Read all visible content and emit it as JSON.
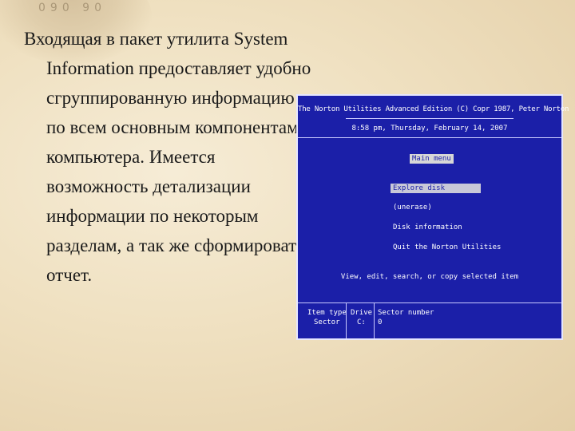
{
  "background": {
    "compass_marks": "090  90"
  },
  "slide": {
    "text": "Входящая в пакет утилита System Information предоставляет удобно сгруппированную информацию по всем основным компонентам компьютера. Имеется возможность детализации информации по некоторым разделам, а так же сформировать отчет."
  },
  "screen": {
    "title": "The Norton Utilities  Advanced Edition  (C) Copr 1987, Peter Norton",
    "datetime": "8:58 pm, Thursday, February 14, 2007",
    "menu_title": "Main menu",
    "menu_items": [
      "Explore disk",
      "(unerase)",
      "Disk information",
      "Quit the Norton Utilities"
    ],
    "hint": "View, edit, search, or copy selected item",
    "footer": {
      "item_type_label": "Item type",
      "item_type_value": "Sector",
      "drive_label": "Drive",
      "drive_value": "C:",
      "sector_label": "Sector number",
      "sector_value": "0"
    },
    "colors": {
      "background": "#1b1fa8",
      "text": "#ffffff",
      "highlight": "#c8c8d8"
    }
  }
}
